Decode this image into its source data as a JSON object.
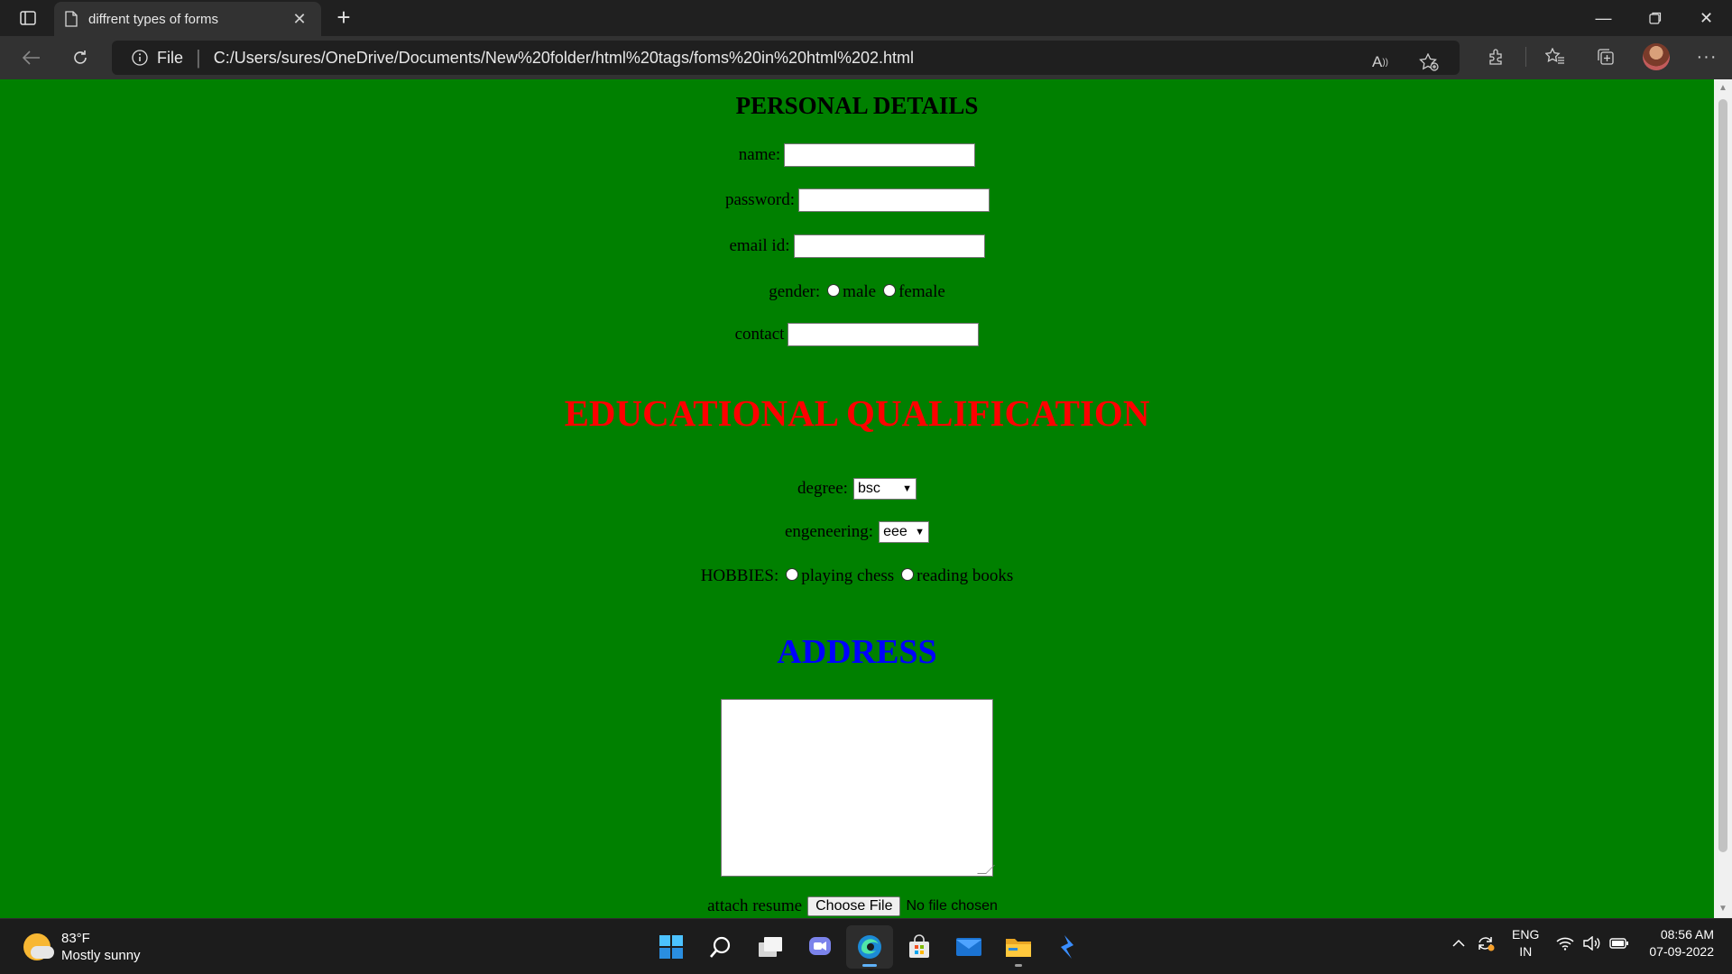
{
  "browser": {
    "tab_title": "diffrent types of forms",
    "url_scheme": "File",
    "url": "C:/Users/sures/OneDrive/Documents/New%20folder/html%20tags/foms%20in%20html%202.html"
  },
  "page": {
    "background": "#008000",
    "personal_heading": "PERSONAL DETAILS",
    "name_label": "name:",
    "password_label": "password:",
    "email_label": "email id:",
    "gender_label": "gender:",
    "gender_options": [
      "male",
      "female"
    ],
    "contact_label": "contact",
    "edu_heading": "EDUCATIONAL QUALIFICATION",
    "edu_heading_color": "#ff0000",
    "degree_label": "degree:",
    "degree_value": "bsc",
    "engineering_label": "engeneering:",
    "engineering_value": "eee",
    "hobbies_label": "HOBBIES:",
    "hobby_options": [
      "playing chess",
      "reading books"
    ],
    "address_heading": "ADDRESS",
    "address_heading_color": "#0000ff",
    "resume_label": "attach resume",
    "file_button": "Choose File",
    "file_status": "No file chosen"
  },
  "taskbar": {
    "temperature": "83°F",
    "weather_desc": "Mostly sunny",
    "lang_top": "ENG",
    "lang_bottom": "IN",
    "time": "08:56 AM",
    "date": "07-09-2022"
  }
}
